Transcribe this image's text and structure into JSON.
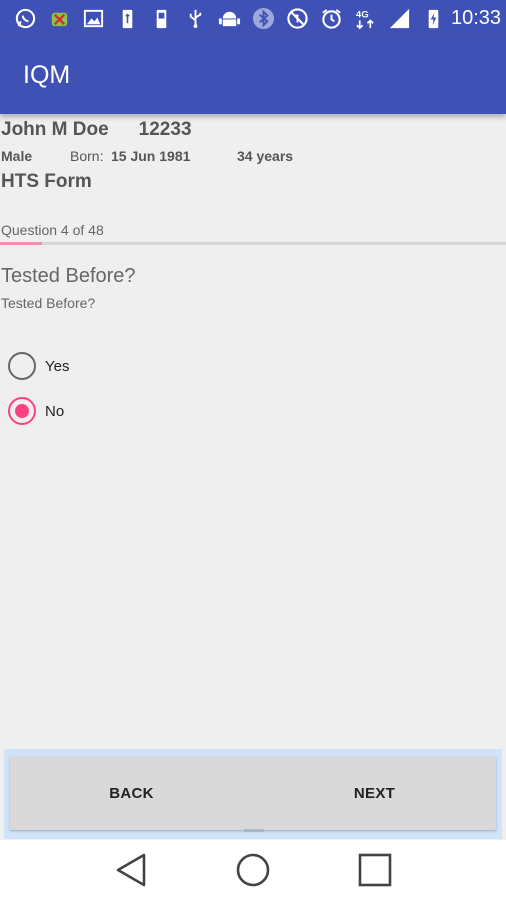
{
  "status_bar": {
    "time": "10:33",
    "icons": [
      "whatsapp-icon",
      "android-debug-icon",
      "image-icon",
      "usb-battery-icon",
      "battery-icon",
      "usb-icon",
      "android-icon",
      "bluetooth-icon",
      "mute-icon",
      "alarm-icon",
      "network-4g-icon",
      "signal-icon",
      "battery-charging-icon"
    ]
  },
  "app_bar": {
    "title": "IQM"
  },
  "patient": {
    "name": "John M Doe",
    "id": "12233",
    "gender": "Male",
    "born_label": "Born:",
    "born_value": "15 Jun 1981",
    "age": "34 years"
  },
  "form": {
    "title": "HTS Form",
    "question_count": "Question 4 of 48",
    "progress_fraction": 0.083
  },
  "question": {
    "title": "Tested Before?",
    "subtitle": "Tested Before?",
    "options": [
      {
        "label": "Yes",
        "selected": false
      },
      {
        "label": "No",
        "selected": true
      }
    ]
  },
  "buttons": {
    "back": "BACK",
    "next": "NEXT"
  },
  "colors": {
    "primary": "#3f51b5",
    "accent": "#ff4081",
    "progress": "#f48fb1"
  },
  "nav_bar": {
    "icons": [
      "back-triangle-icon",
      "home-circle-icon",
      "recents-square-icon"
    ]
  }
}
